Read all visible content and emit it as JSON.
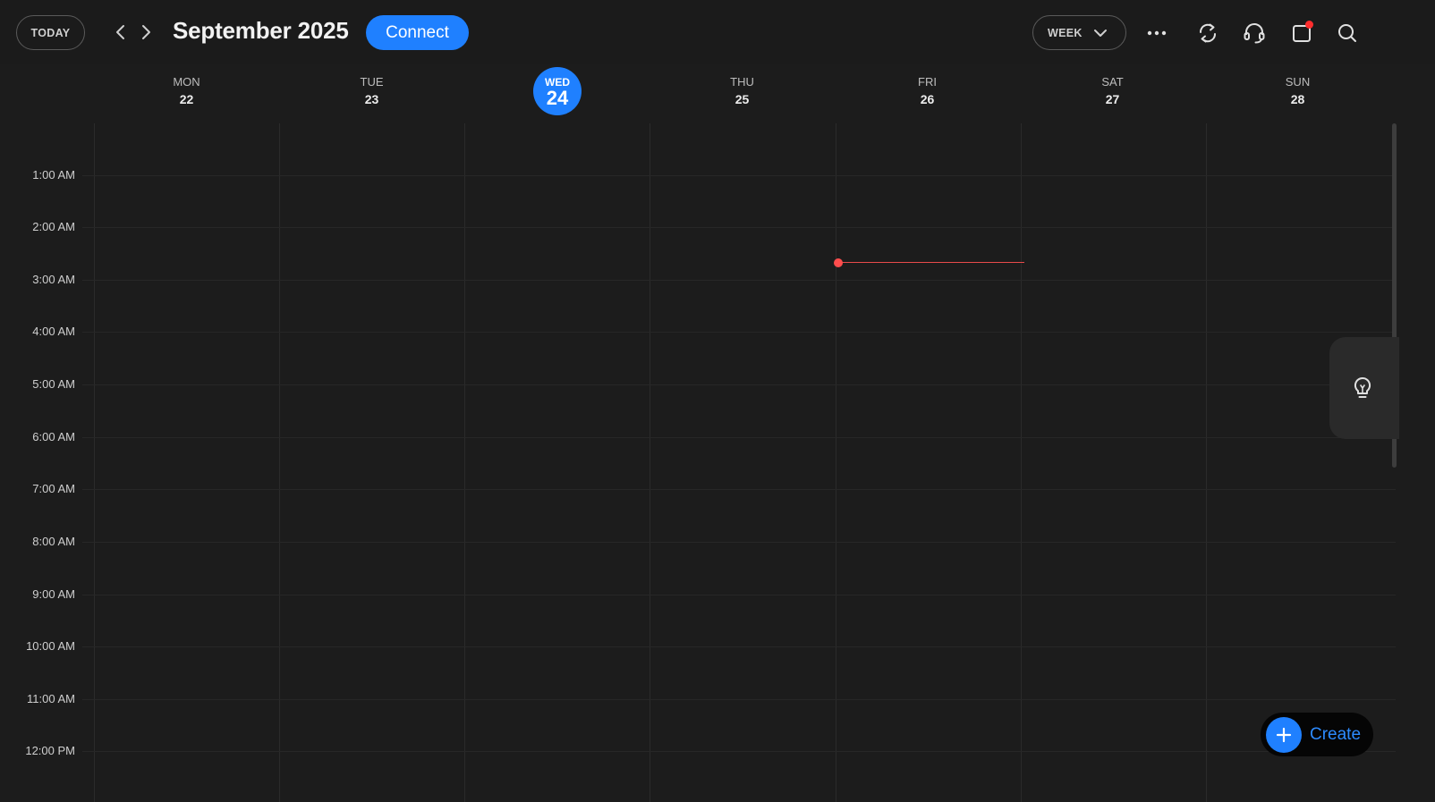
{
  "header": {
    "today_label": "TODAY",
    "month_title": "September 2025",
    "connect_label": "Connect",
    "view_label": "WEEK"
  },
  "icons": {
    "prev": "chevron-left-icon",
    "next": "chevron-right-icon",
    "view_dropdown": "chevron-down-icon",
    "more": "more-horizontal-icon",
    "sync": "sync-icon",
    "support": "headset-icon",
    "notifications": "notification-square-icon",
    "search": "search-icon",
    "tips": "lightbulb-icon",
    "create": "plus-icon"
  },
  "days": [
    {
      "name": "MON",
      "num": "22"
    },
    {
      "name": "TUE",
      "num": "23"
    },
    {
      "name": "WED",
      "num": "24",
      "today": true
    },
    {
      "name": "THU",
      "num": "25"
    },
    {
      "name": "FRI",
      "num": "26"
    },
    {
      "name": "SAT",
      "num": "27"
    },
    {
      "name": "SUN",
      "num": "28"
    }
  ],
  "times": [
    "1:00 AM",
    "2:00 AM",
    "3:00 AM",
    "4:00 AM",
    "5:00 AM",
    "6:00 AM",
    "7:00 AM",
    "8:00 AM",
    "9:00 AM",
    "10:00 AM",
    "11:00 AM",
    "12:00 PM"
  ],
  "create_label": "Create",
  "colors": {
    "accent": "#1f80ff",
    "background": "#1c1c1c",
    "now_indicator": "#ff4d4d",
    "notification_dot": "#ff2d2d"
  }
}
